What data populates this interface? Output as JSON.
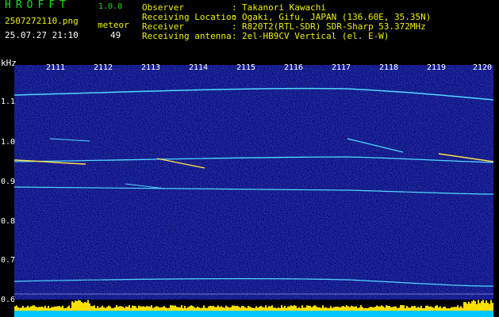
{
  "header": {
    "app_title": "HROFFT",
    "app_version": "1.0.0",
    "file_name": "2507272110.png",
    "timestamp": "25.07.27 21:10",
    "meteor_label": "meteor",
    "meteor_count": "49",
    "info": [
      {
        "label": "Observer",
        "value": "Takanori Kawachi"
      },
      {
        "label": "Receiving Location",
        "value": "Ogaki, Gifu, JAPAN (136.60E, 35.35N)"
      },
      {
        "label": "Receiver",
        "value": "R820T2(RTL-SDR) SDR-Sharp 53.372MHz"
      },
      {
        "label": "Receiving antenna",
        "value": "2el-HB9CV Vertical (el. E-W)"
      }
    ],
    "separator": ":"
  },
  "spectrogram": {
    "unit_label": "kHz",
    "y_ticks": [
      "1.1",
      "1.0",
      "0.9",
      "0.8",
      "0.7",
      "0.6"
    ],
    "y_range": [
      0.6,
      1.2
    ],
    "x_ticks": [
      "2111",
      "2112",
      "2113",
      "2114",
      "2115",
      "2116",
      "2117",
      "2118",
      "2119",
      "2120"
    ],
    "colors": {
      "background": "#0a0a6e",
      "trace": "#4fd8ff",
      "meteor": "#ffe04a",
      "level_bar": "#ffe000",
      "level_base": "#00c8ff"
    }
  }
}
